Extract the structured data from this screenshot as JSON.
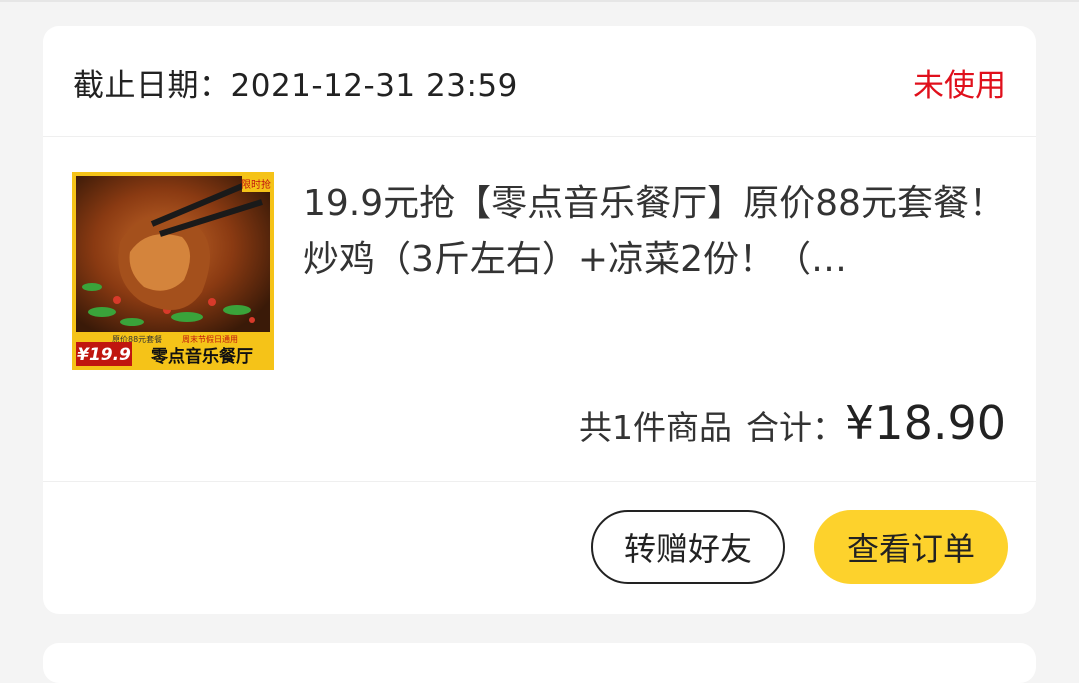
{
  "order": {
    "deadline_text": "截止日期：2021-12-31 23:59",
    "status": "未使用",
    "product_title": "19.9元抢【零点音乐餐厅】原价88元套餐！炒鸡（3斤左右）+凉菜2份！（…",
    "thumb": {
      "tag": "限时抢",
      "orig_price_text": "原价88元套餐",
      "holiday_text": "周末节假日通用",
      "price_badge": "¥19.9",
      "brand_text": "零点音乐餐厅"
    },
    "item_count_text": "共1件商品",
    "total_label": "合计：",
    "total_price": "¥18.90",
    "buttons": {
      "gift": "转赠好友",
      "view": "查看订单"
    }
  },
  "colors": {
    "status_red": "#e0101c",
    "accent_yellow": "#fdd22c",
    "background": "#f4f4f4"
  }
}
